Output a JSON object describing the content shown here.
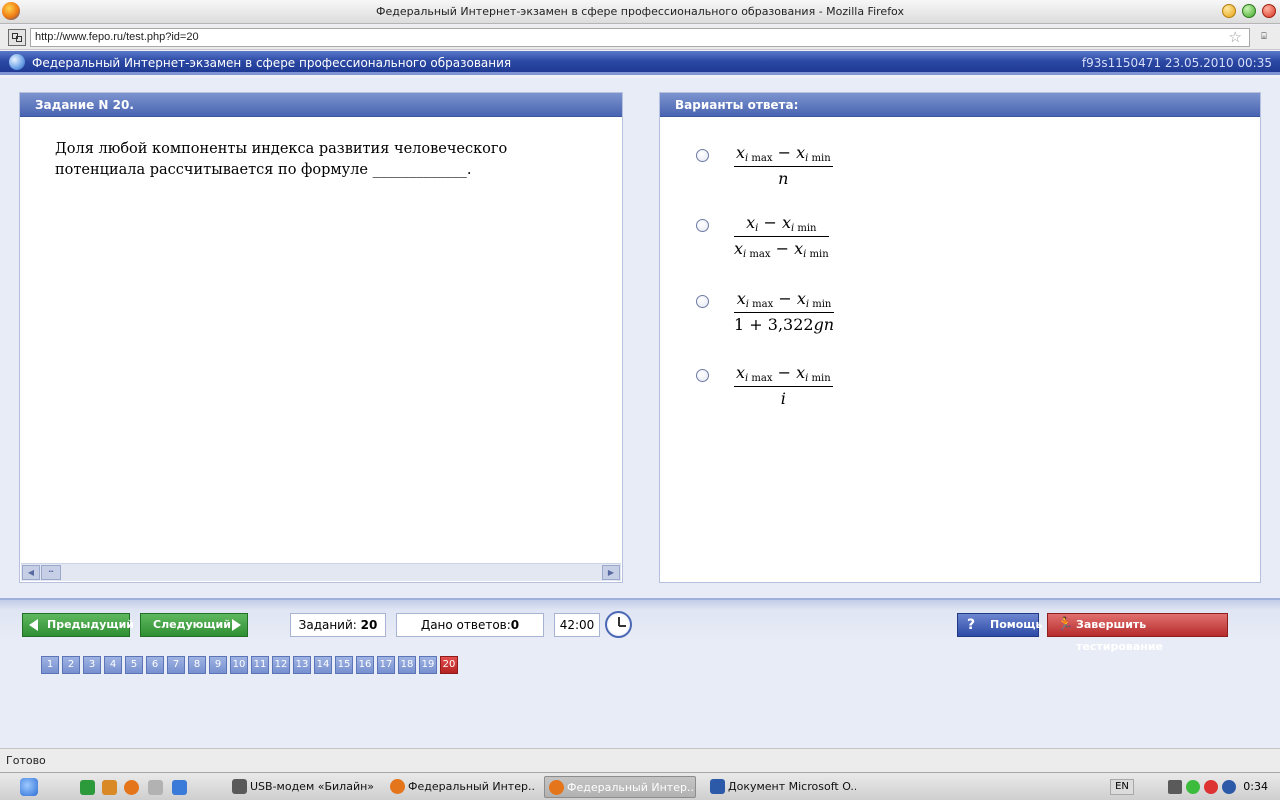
{
  "window": {
    "title": "Федеральный Интернет-экзамен в сфере профессионального образования - Mozilla Firefox"
  },
  "browser": {
    "url": "http://www.fepo.ru/test.php?id=20"
  },
  "app": {
    "title": "Федеральный Интернет-экзамен в сфере профессионального образования",
    "session": "f93s1150471 23.05.2010 00:35"
  },
  "question_panel": {
    "heading": "Задание N 20.",
    "text": "Доля любой компоненты индекса развития человеческого потенциала рассчитывается по формуле _____________."
  },
  "answers_panel": {
    "heading": "Варианты ответа:",
    "options": [
      {
        "label": "(x i max − x i min) / n",
        "selected": false
      },
      {
        "label": "(x i − x i min) / (x i max − x i min)",
        "selected": false
      },
      {
        "label": "(x i max − x i min) / (1 + 3,322 gn)",
        "selected": false
      },
      {
        "label": "(x i max − x i min) / i",
        "selected": false
      }
    ]
  },
  "controls": {
    "prev_label": "Предыдущий",
    "next_label": "Следующий",
    "tasks_label": "Заданий:",
    "tasks_count": "20",
    "answers_label": "Дано ответов:",
    "answers_count": "0",
    "timer": "42:00",
    "help_label": "Помощь",
    "finish_label": "Завершить тестирование"
  },
  "pager": {
    "pages": [
      "1",
      "2",
      "3",
      "4",
      "5",
      "6",
      "7",
      "8",
      "9",
      "10",
      "11",
      "12",
      "13",
      "14",
      "15",
      "16",
      "17",
      "18",
      "19",
      "20"
    ],
    "current": "20"
  },
  "statusbar": {
    "text": "Готово"
  },
  "taskbar": {
    "tasks": [
      {
        "label": "USB-модем «Билайн»",
        "active": false
      },
      {
        "label": "Федеральный Интер...",
        "active": false
      },
      {
        "label": "Федеральный Интер...",
        "active": true
      },
      {
        "label": "Документ Microsoft O...",
        "active": false
      }
    ],
    "lang": "EN",
    "time": "0:34"
  },
  "colors": {
    "header_blue": "#2a47a3",
    "button_green": "#2f8f33",
    "button_red": "#b72c2c",
    "page_active": "#b52222"
  }
}
